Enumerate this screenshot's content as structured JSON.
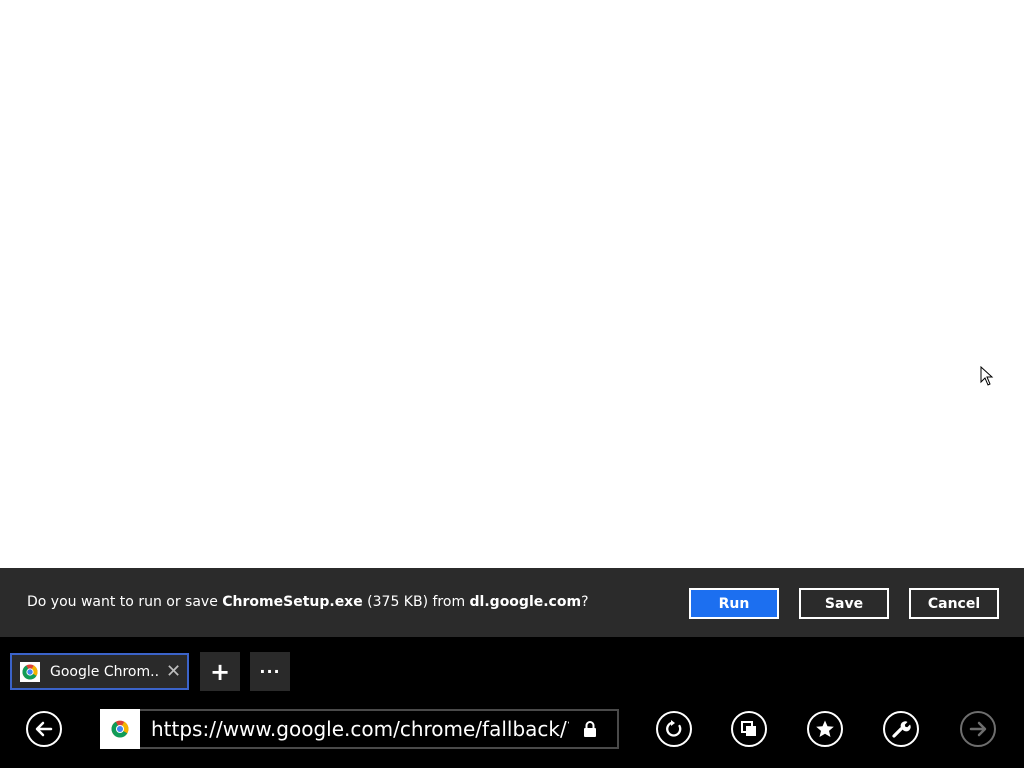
{
  "download_bar": {
    "prompt_prefix": "Do you want to run or save ",
    "file_name": "ChromeSetup.exe",
    "file_size": " (375 KB) from ",
    "source_domain": "dl.google.com",
    "prompt_suffix": "?",
    "run_label": "Run",
    "save_label": "Save",
    "cancel_label": "Cancel",
    "accent_color": "#1c6ff0"
  },
  "tabs": [
    {
      "title": "Google Chrom...",
      "icon": "chrome-logo-icon",
      "close_icon": "close-icon"
    }
  ],
  "tab_controls": {
    "new_tab_label": "+",
    "more_label": "···"
  },
  "address_bar": {
    "url": "https://www.google.com/chrome/fallback/?brand=",
    "favicon": "chrome-logo-icon",
    "secure_icon": "lock-icon"
  },
  "nav_icons": {
    "back": "back-arrow-icon",
    "refresh": "refresh-icon",
    "pin": "pin-to-start-icon",
    "favorites": "star-icon",
    "tools": "wrench-icon",
    "forward": "forward-arrow-icon"
  }
}
